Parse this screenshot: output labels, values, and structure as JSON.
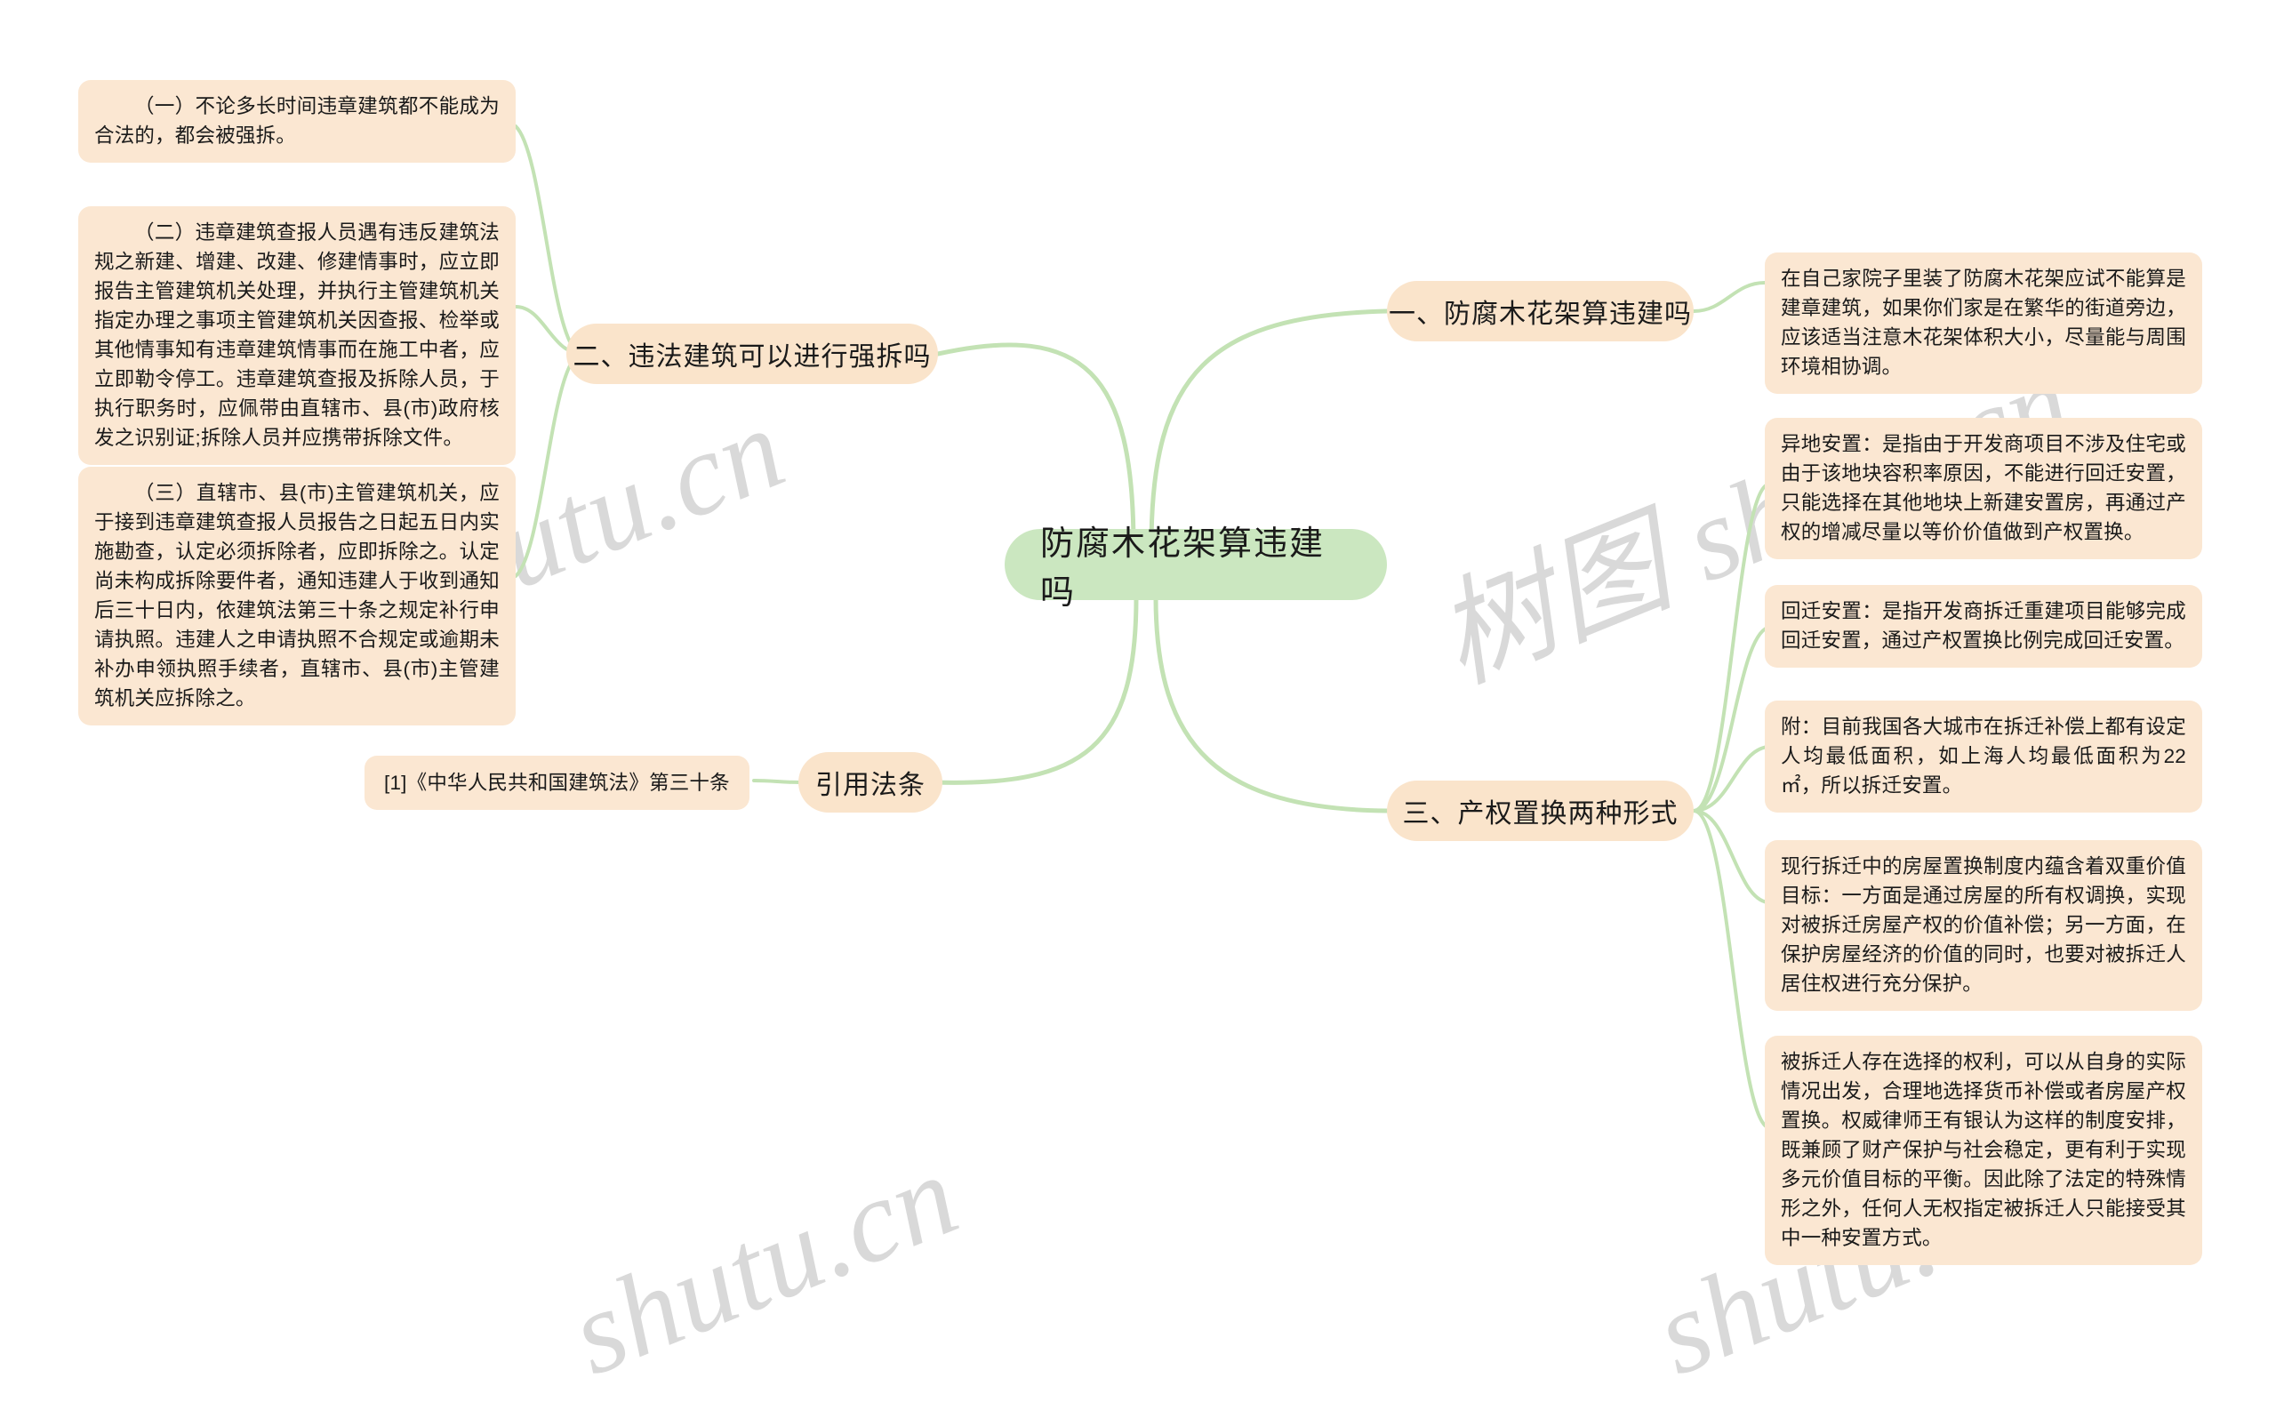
{
  "theme": {
    "root_fill": "#cbe7c0",
    "branch_fill": "#fae4cb",
    "leaf_fill": "#fbe7d2",
    "link_color": "#c3e2b4",
    "text_color": "#1a1a1a",
    "watermark_color": "#d9d9d9",
    "page_background": "#ffffff"
  },
  "watermarks": [
    {
      "text": "shutu.cn"
    },
    {
      "text": "树图 shutu.cn"
    },
    {
      "text": "shutu.cn"
    },
    {
      "text": "shutu.cn"
    }
  ],
  "root": {
    "label": "防腐木花架算违建吗"
  },
  "branches": {
    "b1": {
      "label": "一、防腐木花架算违建吗"
    },
    "b2": {
      "label": "二、违法建筑可以进行强拆吗"
    },
    "b3": {
      "label": "三、产权置换两种形式"
    },
    "b4": {
      "label": "引用法条"
    }
  },
  "leaves": {
    "b1_1": {
      "text": "在自己家院子里装了防腐木花架应试不能算是建章建筑，如果你们家是在繁华的街道旁边，应该适当注意木花架体积大小，尽量能与周围环境相协调。"
    },
    "b2_1": {
      "text": "（一）不论多长时间违章建筑都不能成为合法的，都会被强拆。"
    },
    "b2_2": {
      "text": "（二）违章建筑查报人员遇有违反建筑法规之新建、增建、改建、修建情事时，应立即报告主管建筑机关处理，并执行主管建筑机关指定办理之事项主管建筑机关因查报、检举或其他情事知有违章建筑情事而在施工中者，应立即勒令停工。违章建筑查报及拆除人员，于执行职务时，应佩带由直辖市、县(市)政府核发之识别证;拆除人员并应携带拆除文件。"
    },
    "b2_3": {
      "text": "（三）直辖市、县(市)主管建筑机关，应于接到违章建筑查报人员报告之日起五日内实施勘查，认定必须拆除者，应即拆除之。认定尚未构成拆除要件者，通知违建人于收到通知后三十日内，依建筑法第三十条之规定补行申请执照。违建人之申请执照不合规定或逾期未补办申领执照手续者，直辖市、县(市)主管建筑机关应拆除之。"
    },
    "b3_1": {
      "text": "异地安置：是指由于开发商项目不涉及住宅或由于该地块容积率原因，不能进行回迁安置，只能选择在其他地块上新建安置房，再通过产权的增减尽量以等价价值做到产权置换。"
    },
    "b3_2": {
      "text": "回迁安置：是指开发商拆迁重建项目能够完成回迁安置，通过产权置换比例完成回迁安置。"
    },
    "b3_3": {
      "text": "附：目前我国各大城市在拆迁补偿上都有设定人均最低面积，如上海人均最低面积为22㎡，所以拆迁安置。"
    },
    "b3_4": {
      "text": "现行拆迁中的房屋置换制度内蕴含着双重价值目标：一方面是通过房屋的所有权调换，实现对被拆迁房屋产权的价值补偿；另一方面，在保护房屋经济的价值的同时，也要对被拆迁人居住权进行充分保护。"
    },
    "b3_5": {
      "text": "被拆迁人存在选择的权利，可以从自身的实际情况出发，合理地选择货币补偿或者房屋产权置换。权威律师王有银认为这样的制度安排，既兼顾了财产保护与社会稳定，更有利于实现多元价值目标的平衡。因此除了法定的特殊情形之外，任何人无权指定被拆迁人只能接受其中一种安置方式。"
    },
    "b4_1": {
      "text": "[1]《中华人民共和国建筑法》第三十条"
    }
  }
}
